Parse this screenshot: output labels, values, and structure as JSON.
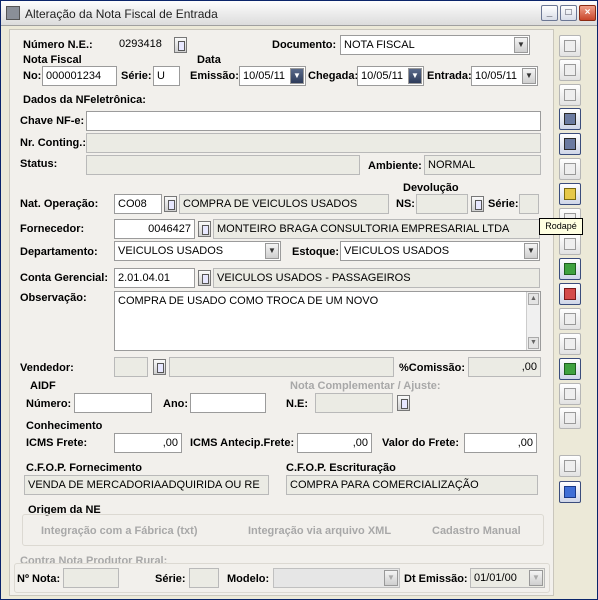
{
  "window": {
    "title": "Alteração da Nota Fiscal de Entrada"
  },
  "header": {
    "numero_ne_label": "Número N.E.:",
    "numero_ne_value": "0293418",
    "documento_label": "Documento:",
    "documento_value": "NOTA FISCAL",
    "nota_fiscal_label": "Nota Fiscal",
    "no_label": "No:",
    "no_value": "000001234",
    "serie_label": "Série:",
    "serie_value": "U",
    "data_label": "Data",
    "emissao_label": "Emissão:",
    "emissao_value": "10/05/11",
    "chegada_label": "Chegada:",
    "chegada_value": "10/05/11",
    "entrada_label": "Entrada:",
    "entrada_value": "10/05/11"
  },
  "nfe": {
    "title": "Dados da NFeletrônica:",
    "chave_label": "Chave NF-e:",
    "chave_value": "",
    "contingencia_label": "Nr. Conting.:",
    "contingencia_value": "",
    "status_label": "Status:",
    "status_value": "",
    "ambiente_label": "Ambiente:",
    "ambiente_value": "NORMAL"
  },
  "operacao": {
    "devolucao_label": "Devolução",
    "nat_label": "Nat. Operação:",
    "nat_code": "CO08",
    "nat_desc": "COMPRA DE VEICULOS USADOS",
    "ns_label": "NS:",
    "ns_value": "",
    "dev_serie_label": "Série:",
    "dev_serie_value": "",
    "fornecedor_label": "Fornecedor:",
    "fornecedor_code": "0046427",
    "fornecedor_name": "MONTEIRO BRAGA CONSULTORIA EMPRESARIAL LTDA",
    "departamento_label": "Departamento:",
    "departamento_value": "VEICULOS USADOS",
    "estoque_label": "Estoque:",
    "estoque_value": "VEICULOS USADOS",
    "conta_label": "Conta Gerencial:",
    "conta_code": "2.01.04.01",
    "conta_desc": "VEICULOS USADOS - PASSAGEIROS",
    "obs_label": "Observação:",
    "obs_value": "COMPRA DE USADO COMO TROCA DE UM NOVO",
    "vendedor_label": "Vendedor:",
    "vendedor_code": "",
    "vendedor_name": "",
    "comissao_label": "%Comissão:",
    "comissao_value": ",00"
  },
  "aidf": {
    "title": "AIDF",
    "numero_label": "Número:",
    "numero_value": "",
    "ano_label": "Ano:",
    "ano_value": ""
  },
  "complementar": {
    "title": "Nota Complementar / Ajuste:",
    "ne_label": "N.E:",
    "ne_value": ""
  },
  "conhecimento": {
    "title": "Conhecimento",
    "icms_frete_label": "ICMS Frete:",
    "icms_frete_value": ",00",
    "icms_antecip_label": "ICMS Antecip.Frete:",
    "icms_antecip_value": ",00",
    "valor_frete_label": "Valor do Frete:",
    "valor_frete_value": ",00"
  },
  "cfop": {
    "fornecimento_label": "C.F.O.P. Fornecimento",
    "fornecimento_value": "VENDA DE MERCADORIAADQUIRIDA OU RE",
    "escrituracao_label": "C.F.O.P. Escrituração",
    "escrituracao_value": "COMPRA PARA COMERCIALIZAÇÃO"
  },
  "origem": {
    "title": "Origem da NE",
    "options": [
      "Integração com a Fábrica (txt)",
      "Integração via arquivo XML",
      "Cadastro Manual"
    ]
  },
  "produtor": {
    "title": "Contra Nota Produtor Rural:",
    "nota_label": "Nº Nota:",
    "nota_value": "",
    "serie_label": "Série:",
    "serie_value": "",
    "modelo_label": "Modelo:",
    "modelo_value": "",
    "dt_label": "Dt Emissão:",
    "dt_value": "01/01/00"
  },
  "toolbar": {
    "tooltip": "Rodapé"
  }
}
